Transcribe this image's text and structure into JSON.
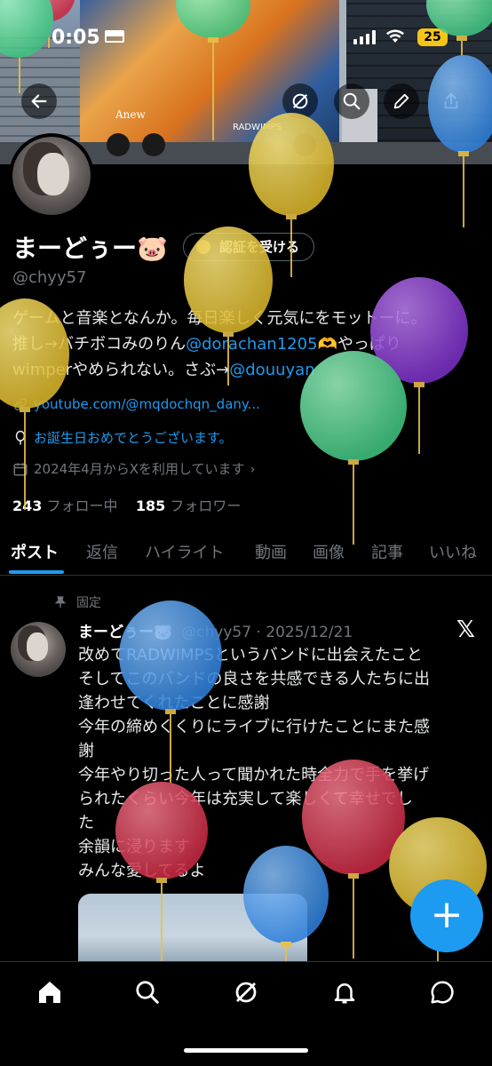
{
  "status_bar": {
    "time": "0:05",
    "battery": "25"
  },
  "banner": {
    "truck_text": "Anew",
    "truck_brand": "RADWIMPS"
  },
  "profile": {
    "name": "まーどぅー🐷",
    "verify_label": "認証を受ける",
    "handle": "@chyy57",
    "bio_line1": "ゲームと音楽となんか。毎日楽しく元気にをモットーに。",
    "bio_line2_prefix": "推し→バチボコみのりん",
    "bio_line2_link": "@dorachan1205",
    "bio_line2_suffix": "🫶やっぱり",
    "bio_line3_prefix": "wimperやめられない。さぶ→",
    "bio_line3_link": "@douuyan",
    "website": "youtube.com/@mqdochqn_dany...",
    "birthday": "お誕生日おめでとうございます。",
    "joined": "2024年4月からXを利用しています",
    "following_count": "243",
    "following_label": "フォロー中",
    "followers_count": "185",
    "followers_label": "フォロワー"
  },
  "tabs": [
    "ポスト",
    "返信",
    "ハイライト",
    "動画",
    "画像",
    "記事",
    "いいね"
  ],
  "post": {
    "pinned_label": "固定",
    "author_name": "まーどぅー🐷",
    "author_meta": "@chyy57 · 2025/12/21",
    "lines": [
      "改めてRADWIMPSというバンドに出会えたこと",
      "そしてこのバンドの良さを共感できる人たちに出",
      "逢わせてくれたことに感謝",
      "今年の締めくくりにライブに行けたことにまた感",
      "謝",
      "今年やり切った人って聞かれた時全力で手を挙げ",
      "られたくらい今年は充実して楽しくて幸せでし",
      "た",
      "余韻に浸ります",
      "みんな愛してるよ"
    ]
  },
  "fab_label": "+",
  "icons": {
    "back": "back-arrow-icon",
    "grok": "grok-icon",
    "search": "search-icon",
    "edit": "edit-icon",
    "share": "share-icon",
    "home": "home-icon",
    "nav_search": "search-icon",
    "nav_grok": "grok-icon",
    "notifications": "bell-icon",
    "messages": "messages-icon"
  },
  "colors": {
    "accent": "#1d9bf0",
    "background": "#000000",
    "secondary_text": "#71767b",
    "balloon_yellow": "#e2c23a",
    "balloon_green": "#4fd08e",
    "balloon_purple": "#8e3ed6",
    "balloon_blue": "#3e8ee6",
    "balloon_red": "#d63a4f"
  }
}
